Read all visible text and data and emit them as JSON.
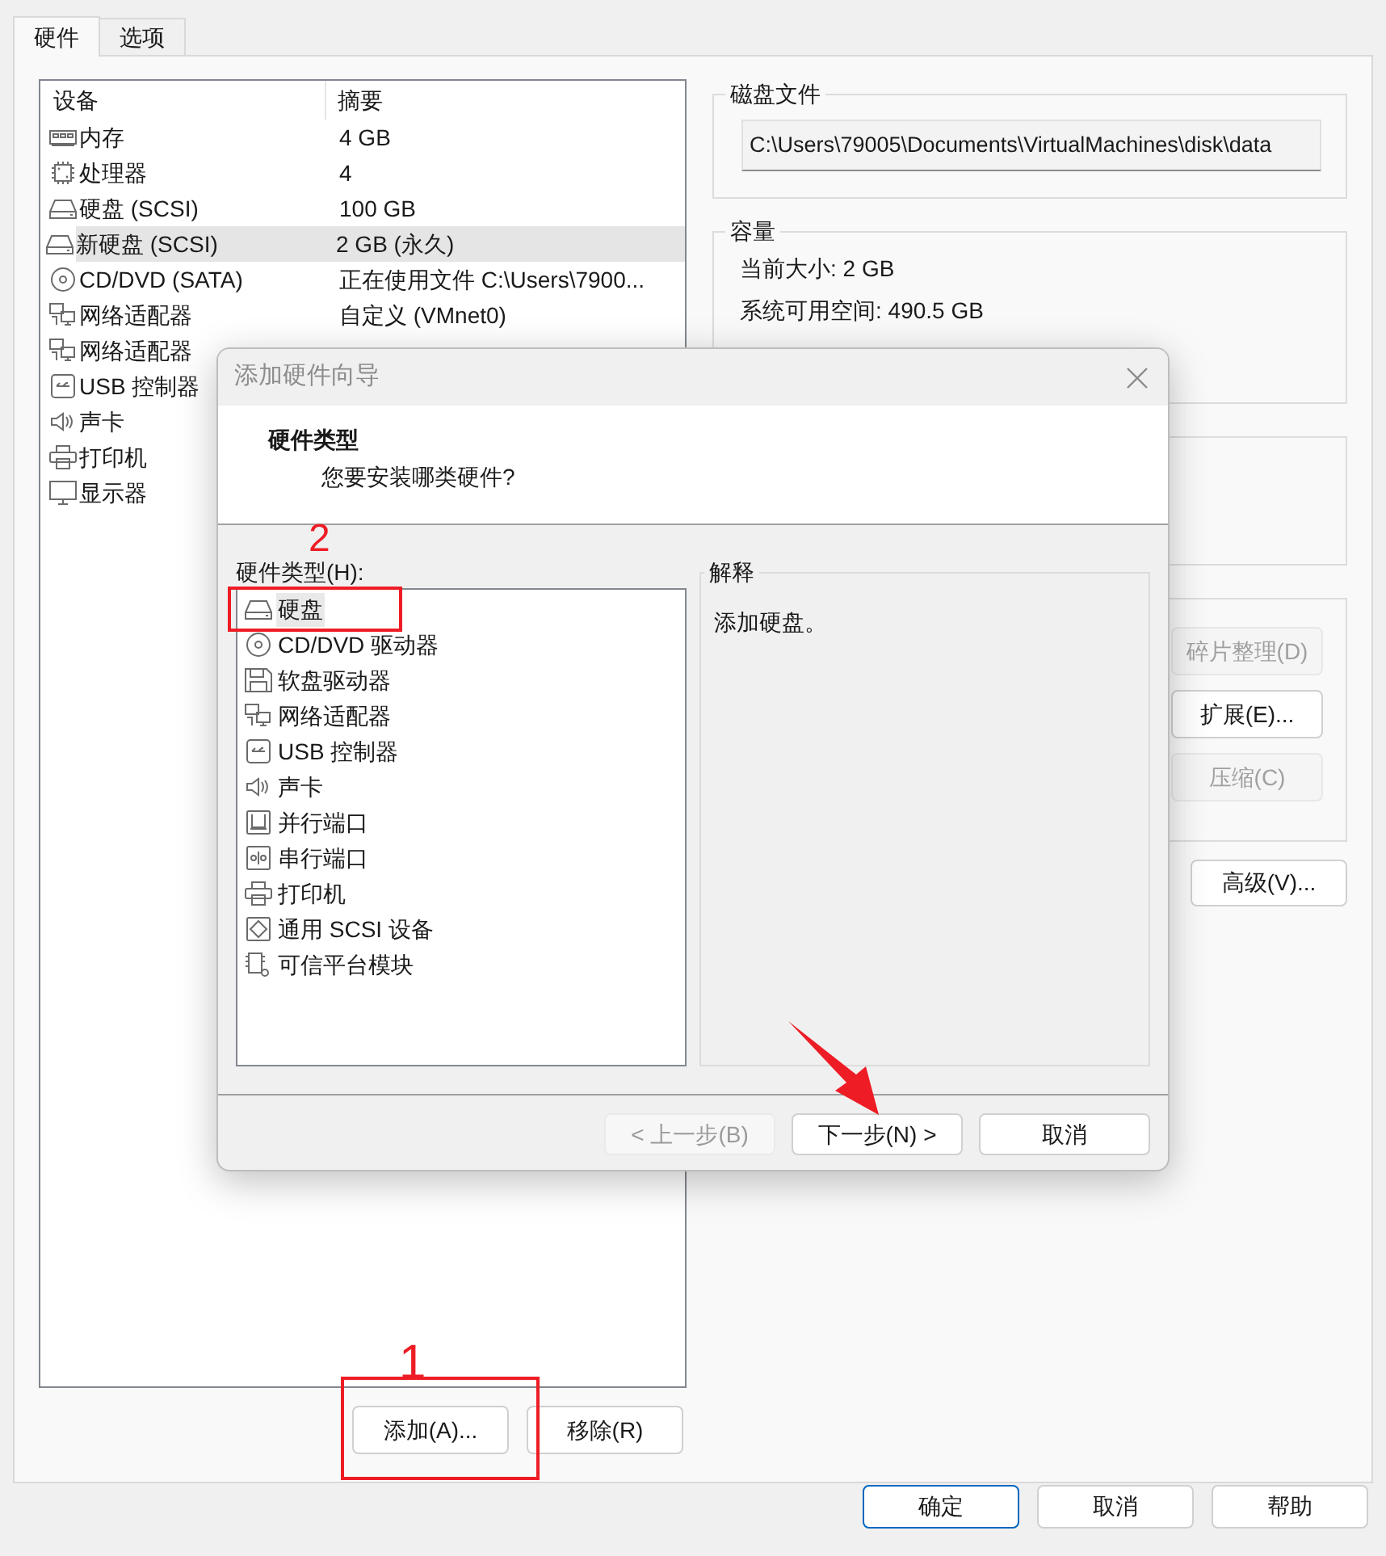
{
  "tabs": [
    {
      "label": "硬件",
      "selected": true
    },
    {
      "label": "选项",
      "selected": false
    }
  ],
  "device_list": {
    "columns": [
      "设备",
      "摘要"
    ],
    "rows": [
      {
        "kind": "memory",
        "device": "内存",
        "summary": "4 GB",
        "selected": false
      },
      {
        "kind": "processor",
        "device": "处理器",
        "summary": "4",
        "selected": false
      },
      {
        "kind": "disk",
        "device": "硬盘 (SCSI)",
        "summary": "100 GB",
        "selected": false
      },
      {
        "kind": "disk",
        "device": "新硬盘 (SCSI)",
        "summary": "2 GB (永久)",
        "selected": true
      },
      {
        "kind": "cdrom",
        "device": "CD/DVD (SATA)",
        "summary": "正在使用文件 C:\\Users\\7900...",
        "selected": false
      },
      {
        "kind": "network",
        "device": "网络适配器",
        "summary": "自定义 (VMnet0)",
        "selected": false
      },
      {
        "kind": "network",
        "device": "网络适配器",
        "selected": false
      },
      {
        "kind": "usb",
        "device": "USB 控制器",
        "selected": false
      },
      {
        "kind": "sound",
        "device": "声卡",
        "selected": false
      },
      {
        "kind": "printer",
        "device": "打印机",
        "selected": false
      },
      {
        "kind": "display",
        "device": "显示器",
        "selected": false
      }
    ]
  },
  "list_buttons": [
    {
      "label": "添加(A)..."
    },
    {
      "label": "移除(R)"
    }
  ],
  "disk_file": {
    "title": "磁盘文件",
    "path": "C:\\Users\\79005\\Documents\\VirtualMachines\\disk\\data"
  },
  "capacity": {
    "title": "容量",
    "lines": [
      "当前大小: 2 GB",
      "系统可用空间: 490.5 GB"
    ]
  },
  "disk_tools": [
    {
      "label": "碎片整理(D)",
      "disabled": true
    },
    {
      "label": "扩展(E)...",
      "disabled": false
    },
    {
      "label": "压缩(C)",
      "disabled": true
    }
  ],
  "advanced_button": "高级(V)...",
  "footer_buttons": [
    {
      "label": "确定",
      "default": true
    },
    {
      "label": "取消",
      "default": false
    },
    {
      "label": "帮助",
      "default": false
    }
  ],
  "dialog": {
    "title": "添加硬件向导",
    "heading": "硬件类型",
    "subheading": "您要安装哪类硬件?",
    "list_label": "硬件类型(H):",
    "items": [
      {
        "kind": "disk",
        "label": "硬盘",
        "selected": true
      },
      {
        "kind": "cdrom",
        "label": "CD/DVD 驱动器",
        "selected": false
      },
      {
        "kind": "floppy",
        "label": "软盘驱动器",
        "selected": false
      },
      {
        "kind": "network",
        "label": "网络适配器",
        "selected": false
      },
      {
        "kind": "usb",
        "label": "USB 控制器",
        "selected": false
      },
      {
        "kind": "sound",
        "label": "声卡",
        "selected": false
      },
      {
        "kind": "parallel",
        "label": "并行端口",
        "selected": false
      },
      {
        "kind": "serial",
        "label": "串行端口",
        "selected": false
      },
      {
        "kind": "printer",
        "label": "打印机",
        "selected": false
      },
      {
        "kind": "scsi",
        "label": "通用 SCSI 设备",
        "selected": false
      },
      {
        "kind": "tpm",
        "label": "可信平台模块",
        "selected": false
      }
    ],
    "explanation": {
      "title": "解释",
      "text": "添加硬盘。"
    },
    "buttons": [
      {
        "label": "< 上一步(B)",
        "disabled": true
      },
      {
        "label": "下一步(N) >",
        "disabled": false
      },
      {
        "label": "取消",
        "disabled": false
      }
    ]
  },
  "annotations": [
    {
      "text": "1"
    },
    {
      "text": "2"
    }
  ]
}
